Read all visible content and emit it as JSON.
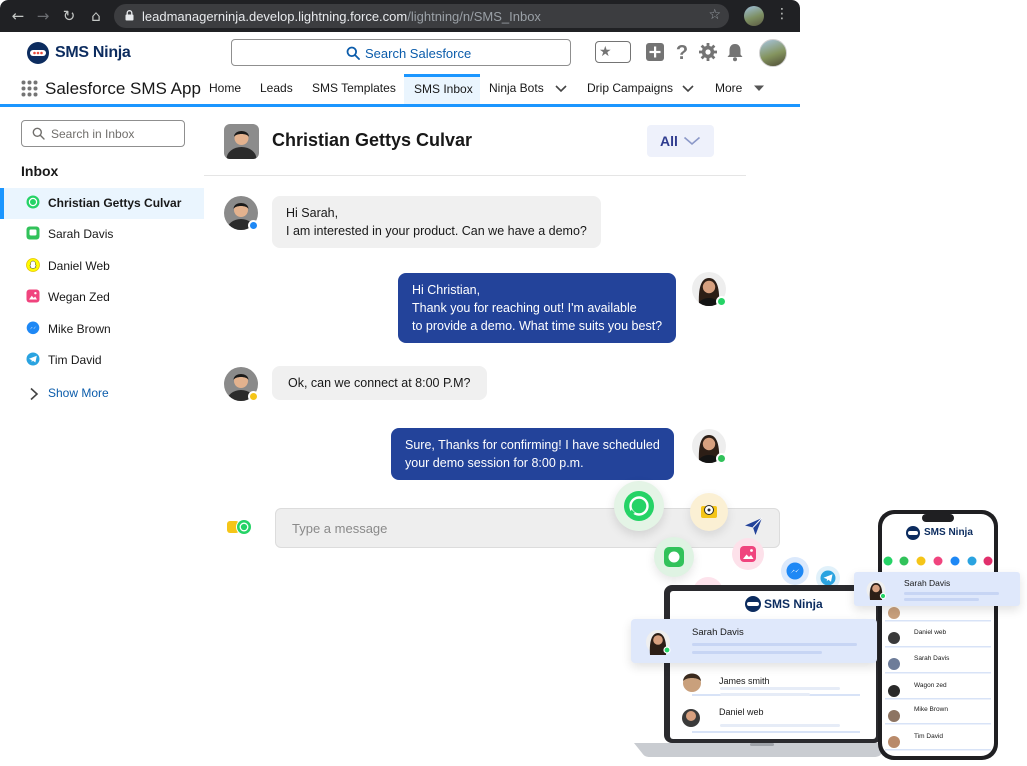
{
  "browser": {
    "url_host": "leadmanagerninja.develop.lightning.force.com",
    "url_path": "/lightning/n/SMS_Inbox"
  },
  "header": {
    "brand": "SMS Ninja",
    "search_placeholder": "Search Salesforce"
  },
  "app_nav": {
    "app_name": "Salesforce SMS App",
    "tabs": [
      {
        "label": "Home"
      },
      {
        "label": "Leads"
      },
      {
        "label": "SMS Templates"
      },
      {
        "label": "SMS Inbox"
      },
      {
        "label": "Ninja Bots"
      },
      {
        "label": "Drip Campaigns"
      },
      {
        "label": "More"
      }
    ],
    "active_tab": "SMS Inbox"
  },
  "inbox": {
    "search_placeholder": "Search in Inbox",
    "heading": "Inbox",
    "contacts": [
      {
        "name": "Christian Gettys Culvar",
        "channel": "whatsapp-icon",
        "active": true
      },
      {
        "name": "Sarah Davis",
        "channel": "sms-icon"
      },
      {
        "name": "Daniel Web",
        "channel": "snapchat-icon"
      },
      {
        "name": "Wegan Zed",
        "channel": "photo-message-icon"
      },
      {
        "name": "Mike Brown",
        "channel": "messenger-icon"
      },
      {
        "name": "Tim David",
        "channel": "telegram-icon"
      }
    ],
    "show_more": "Show More"
  },
  "conversation": {
    "contact_name": "Christian Gettys Culvar",
    "filter": "All",
    "messages": [
      {
        "direction": "in",
        "lines": [
          "Hi Sarah,",
          "I am interested in your product. Can we have a demo?"
        ]
      },
      {
        "direction": "out",
        "lines": [
          "Hi Christian,",
          "Thank you for reaching out! I'm available",
          "to provide a demo. What time suits you best?"
        ]
      },
      {
        "direction": "in",
        "lines": [
          "Ok, can we connect at 8:00 P.M?"
        ]
      },
      {
        "direction": "out",
        "lines": [
          "Sure, Thanks for confirming! I have scheduled",
          "your demo session for 8:00 p.m."
        ]
      }
    ],
    "composer_placeholder": "Type a message"
  },
  "promo": {
    "laptop": {
      "brand": "SMS Ninja",
      "highlight_contact": "Sarah Davis",
      "contacts": [
        "James smith",
        "Daniel web"
      ]
    },
    "phone": {
      "brand": "SMS Ninja",
      "highlight_contact": "Sarah Davis",
      "contacts": [
        "Daniel web",
        "Sarah Davis",
        "Wagon zed",
        "Mike Brown",
        "Tim David"
      ]
    }
  },
  "colors": {
    "accent": "#1b96ff",
    "outgoing_bubble": "#23439a",
    "incoming_bubble": "#f0f0f0",
    "brand_navy": "#0c2c5f",
    "whatsapp": "#25d366"
  }
}
